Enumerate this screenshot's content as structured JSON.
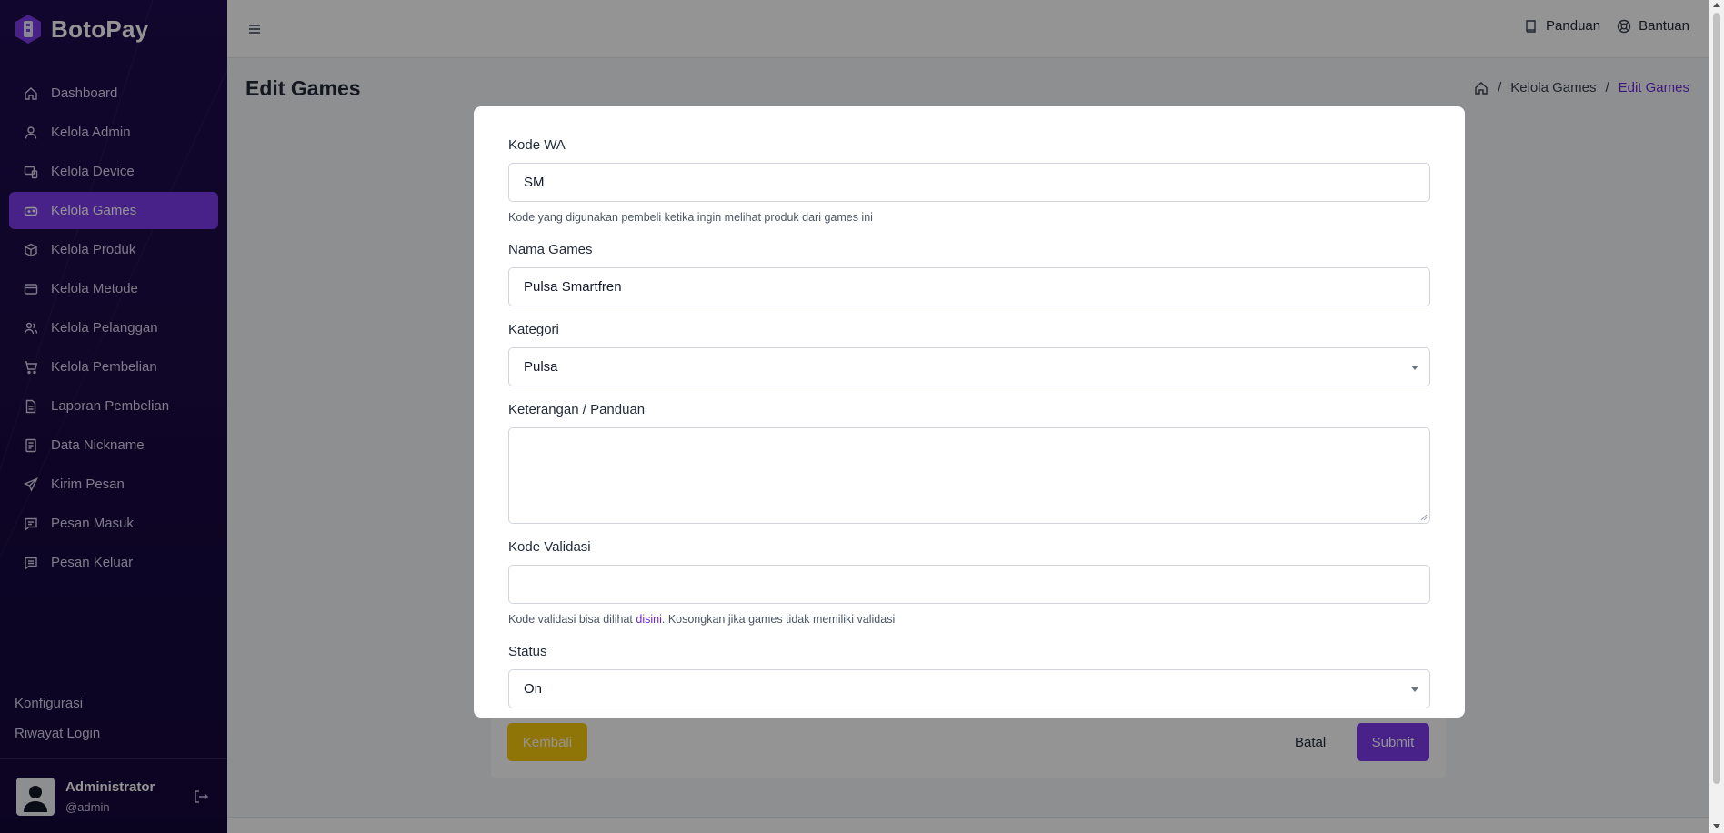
{
  "brand": {
    "name": "BotoPay"
  },
  "sidebar": {
    "items": [
      {
        "label": "Dashboard",
        "icon": "home-icon",
        "active": false
      },
      {
        "label": "Kelola Admin",
        "icon": "user-icon",
        "active": false
      },
      {
        "label": "Kelola Device",
        "icon": "device-icon",
        "active": false
      },
      {
        "label": "Kelola Games",
        "icon": "gamepad-icon",
        "active": true
      },
      {
        "label": "Kelola Produk",
        "icon": "box-icon",
        "active": false
      },
      {
        "label": "Kelola Metode",
        "icon": "credit-card-icon",
        "active": false
      },
      {
        "label": "Kelola Pelanggan",
        "icon": "users-icon",
        "active": false
      },
      {
        "label": "Kelola Pembelian",
        "icon": "cart-icon",
        "active": false
      },
      {
        "label": "Laporan Pembelian",
        "icon": "document-icon",
        "active": false
      },
      {
        "label": "Data Nickname",
        "icon": "file-list-icon",
        "active": false
      },
      {
        "label": "Kirim Pesan",
        "icon": "send-icon",
        "active": false
      },
      {
        "label": "Pesan Masuk",
        "icon": "message-in-icon",
        "active": false
      },
      {
        "label": "Pesan Keluar",
        "icon": "message-out-icon",
        "active": false
      }
    ],
    "links": [
      "Konfigurasi",
      "Riwayat Login"
    ],
    "profile": {
      "name": "Administrator",
      "username": "@admin"
    }
  },
  "topbar": {
    "guide_label": "Panduan",
    "help_label": "Bantuan"
  },
  "page": {
    "title": "Edit Games",
    "breadcrumb": [
      "Kelola Games",
      "Edit Games"
    ]
  },
  "form": {
    "kode_wa": {
      "label": "Kode WA",
      "value": "SM",
      "help": "Kode yang digunakan pembeli ketika ingin melihat produk dari games ini"
    },
    "nama_games": {
      "label": "Nama Games",
      "value": "Pulsa Smartfren"
    },
    "kategori": {
      "label": "Kategori",
      "value": "Pulsa"
    },
    "keterangan": {
      "label": "Keterangan / Panduan",
      "value": ""
    },
    "kode_validasi": {
      "label": "Kode Validasi",
      "value": "",
      "help_prefix": "Kode validasi bisa dilihat ",
      "help_link": "disini",
      "help_suffix": ". Kosongkan jika games tidak memiliki validasi"
    },
    "status": {
      "label": "Status",
      "value": "On"
    },
    "back_label": "Kembali",
    "cancel_label": "Batal",
    "submit_label": "Submit"
  },
  "colors": {
    "accent": "#7c3aed",
    "sidebar_bg": "#1e0c4e",
    "warning": "#f6c90e"
  }
}
